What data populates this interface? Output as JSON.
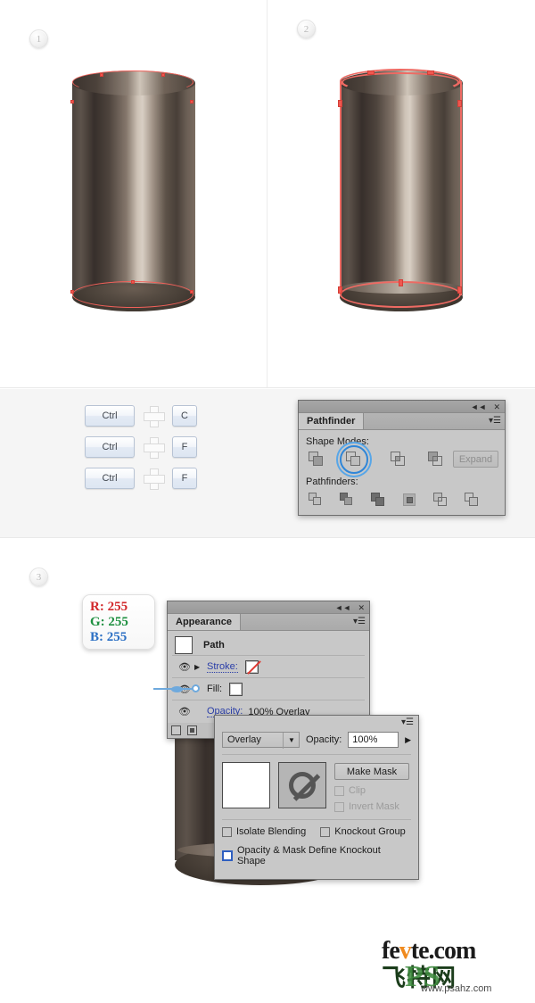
{
  "steps": [
    {
      "number": "1"
    },
    {
      "number": "2"
    },
    {
      "number": "3"
    }
  ],
  "shortcuts": {
    "plus_icon": "plus-icon",
    "rows": [
      {
        "modifier": "Ctrl",
        "key": "C"
      },
      {
        "modifier": "Ctrl",
        "key": "F"
      },
      {
        "modifier": "Ctrl",
        "key": "F"
      }
    ]
  },
  "pathfinder_panel": {
    "tab_label": "Pathfinder",
    "collapse_icon": "collapse-icon",
    "close_icon": "close-icon",
    "menu_icon": "panel-menu-icon",
    "shape_modes_label": "Shape Modes:",
    "pathfinders_label": "Pathfinders:",
    "expand_label": "Expand",
    "shape_modes": [
      {
        "name": "unite-icon",
        "selected": false
      },
      {
        "name": "minus-front-icon",
        "selected": true
      },
      {
        "name": "intersect-icon",
        "selected": false
      },
      {
        "name": "exclude-icon",
        "selected": false
      }
    ],
    "pathfinders": [
      {
        "name": "divide-icon"
      },
      {
        "name": "trim-icon"
      },
      {
        "name": "merge-icon"
      },
      {
        "name": "crop-icon"
      },
      {
        "name": "outline-icon"
      },
      {
        "name": "minus-back-icon"
      }
    ]
  },
  "appearance_panel": {
    "tab_label": "Appearance",
    "collapse_icon": "collapse-icon",
    "close_icon": "close-icon",
    "menu_icon": "panel-menu-icon",
    "item_label": "Path",
    "rows": [
      {
        "label": "Stroke:",
        "swatch": "none"
      },
      {
        "label": "Fill:",
        "swatch": "white"
      }
    ],
    "opacity_label": "Opacity:",
    "opacity_value": "100% Overlay"
  },
  "rgb_callout": {
    "r": "R: 255",
    "g": "G: 255",
    "b": "B: 255",
    "r_color": "#d2282b",
    "g_color": "#1e9040",
    "b_color": "#2b6fc4"
  },
  "transparency_panel": {
    "menu_icon": "panel-menu-icon",
    "blend_mode": "Overlay",
    "blend_caret_icon": "chevron-down-icon",
    "opacity_label": "Opacity:",
    "opacity_value": "100%",
    "opacity_spinner_icon": "play-right-icon",
    "make_mask_label": "Make Mask",
    "mask_thumb_icon": "no-mask-icon",
    "clip_label": "Clip",
    "invert_mask_label": "Invert Mask",
    "isolate_blending_label": "Isolate Blending",
    "knockout_group_label": "Knockout Group",
    "knockout_shape_label": "Opacity & Mask Define Knockout Shape",
    "highlight_color": "#2f5fc0"
  },
  "watermark": {
    "brand_a": "fe",
    "brand_v": "v",
    "brand_b": "te.com",
    "brand_cn": "飞特网",
    "ps_label": "PS",
    "url": "www.psahz.com"
  },
  "artwork": {
    "cylinder_label": "metal-cylinder",
    "anchor_color": "#f0574f",
    "path_color": "#ee6a63"
  }
}
